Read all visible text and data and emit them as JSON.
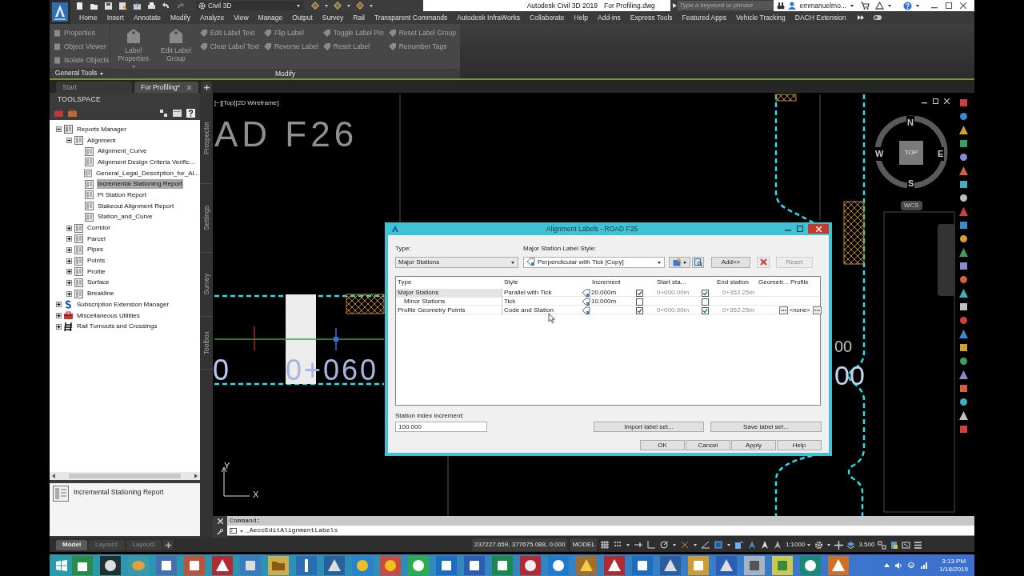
{
  "title_bar": {
    "workspace": "Civil 3D",
    "app_title": "Autodesk Civil 3D 2019",
    "file_name": "For Profiling.dwg",
    "search": {
      "placeholder": "Type a keyword or phrase"
    },
    "user": "emmanuelmo..."
  },
  "ribbon_tabs": [
    "Home",
    "Insert",
    "Annotate",
    "Modify",
    "Analyze",
    "View",
    "Manage",
    "Output",
    "Survey",
    "Rail",
    "Transparent Commands",
    "Autodesk InfraWorks",
    "Collaborate",
    "Help",
    "Add-ins",
    "Express Tools",
    "Featured Apps",
    "Vehicle Tracking",
    "DACH Extension"
  ],
  "ribbon_panels": [
    {
      "title": "General Tools",
      "items": [
        {
          "kind": "small",
          "label": "Properties",
          "disabled": true
        },
        {
          "kind": "small",
          "label": "Object Viewer",
          "disabled": true
        },
        {
          "kind": "small",
          "label": "Isolate Objects",
          "disabled": true
        }
      ]
    },
    {
      "title": "Modify",
      "items": [
        {
          "kind": "large",
          "label": "Label Properties",
          "disabled": true
        },
        {
          "kind": "large",
          "label": "Edit Label Group",
          "disabled": true
        },
        {
          "kind": "small",
          "label": "Edit Label Text",
          "disabled": true
        },
        {
          "kind": "small",
          "label": "Clear Label Text",
          "disabled": true
        },
        {
          "kind": "small",
          "label": "Flip Label",
          "disabled": true
        },
        {
          "kind": "small",
          "label": "Reverse Label",
          "disabled": true
        },
        {
          "kind": "small",
          "label": "Toggle Label Pin",
          "disabled": true
        },
        {
          "kind": "small",
          "label": "Reset Label",
          "disabled": true
        },
        {
          "kind": "small",
          "label": "Reset Label Group",
          "disabled": true
        },
        {
          "kind": "small",
          "label": "Renumber Tags",
          "disabled": true
        }
      ]
    }
  ],
  "file_tabs": [
    {
      "label": "Start",
      "selected": false
    },
    {
      "label": "For Profiling*",
      "selected": true
    }
  ],
  "toolspace": {
    "title": "TOOLSPACE",
    "tree": [
      {
        "label": "Reports Manager",
        "expanded": true,
        "selected": false,
        "children": [
          {
            "label": "Alignment",
            "expanded": true,
            "selected": false,
            "children": [
              {
                "label": "Alignment_Curve",
                "selected": false
              },
              {
                "label": "Alignment Design Criteria Verific...",
                "selected": false
              },
              {
                "label": "General_Legal_Description_for_Al...",
                "selected": false
              },
              {
                "label": "Incremental Stationing Report",
                "selected": true
              },
              {
                "label": "PI Station Report",
                "selected": false
              },
              {
                "label": "Stakeout Alignment Report",
                "selected": false
              },
              {
                "label": "Station_and_Curve",
                "selected": false
              }
            ]
          },
          {
            "label": "Corridor",
            "expanded": false,
            "selected": false
          },
          {
            "label": "Parcel",
            "expanded": false,
            "selected": false
          },
          {
            "label": "Pipes",
            "expanded": false,
            "selected": false
          },
          {
            "label": "Points",
            "expanded": false,
            "selected": false
          },
          {
            "label": "Profile",
            "expanded": false,
            "selected": false
          },
          {
            "label": "Surface",
            "expanded": false,
            "selected": false
          },
          {
            "label": "Breakline",
            "expanded": false,
            "selected": false
          }
        ]
      },
      {
        "label": "Subscription Extension Manager",
        "expanded": false,
        "selected": false
      },
      {
        "label": "Miscellaneous Utilities",
        "expanded": false,
        "selected": false
      },
      {
        "label": "Rail Turnouts and Crossings",
        "expanded": false,
        "selected": false
      }
    ],
    "side_tabs": [
      "Prospector",
      "Settings",
      "Survey",
      "Toolbox"
    ],
    "preview": "Incremental Stationing Report"
  },
  "viewport": {
    "label": "[−][Top][2D Wireframe]",
    "texts": [
      "AD F26",
      "0",
      "0+060",
      "00",
      "00"
    ],
    "viewcube": {
      "north": "N",
      "south": "S",
      "east": "E",
      "west": "W",
      "top": "TOP",
      "wcs": "WCS"
    },
    "ucs": {
      "x": "X",
      "y": "Y"
    }
  },
  "dialog": {
    "title": "Alignment Labels - ROAD F25",
    "type_label": "Type:",
    "type_value": "Major Stations",
    "style_label": "Major Station Label Style:",
    "style_value": "Perpendicular with Tick [Copy]",
    "add_button": "Add>>",
    "reset_button": {
      "label": "Reset",
      "disabled": true
    },
    "columns": [
      "Type",
      "Style",
      "Increment",
      "",
      "Start sta...",
      "",
      "End station",
      "Geometr...",
      "Profile"
    ],
    "rows": [
      {
        "type": "Major Stations",
        "style": "Parallel with Tick",
        "increment": "20.000m",
        "start_checked": true,
        "start_station": "0+000.00m",
        "end_checked": true,
        "end_station": "0+352.25m",
        "geometry_picker": false,
        "selected": true,
        "children": [
          {
            "type": "Minor Stations",
            "style": "Tick",
            "increment": "10.000m",
            "start_checked": false,
            "end_checked": false,
            "geometry_picker": false,
            "selected": false
          }
        ]
      },
      {
        "type": "Profile Geometry Points",
        "style": "Code and Station",
        "start_checked": true,
        "start_station": "0+000.00m",
        "end_checked": true,
        "end_station": "0+352.25m",
        "geometry_picker": true,
        "profile": "<none>",
        "selected": false
      }
    ],
    "index_label": "Station index increment:",
    "index_value": "100.000",
    "buttons": [
      "Import label set...",
      "Save label set..."
    ],
    "footer_buttons": [
      "OK",
      "Cancel",
      "Apply",
      "Help"
    ]
  },
  "command_line": {
    "history": "Command:",
    "input": "_AeccEditAlignmentLabels"
  },
  "layout_tabs": [
    {
      "label": "Model",
      "selected": true
    },
    {
      "label": "Layout1",
      "selected": false
    },
    {
      "label": "Layout2",
      "selected": false
    }
  ],
  "status_bar": {
    "coordinates": "237227.659, 377675.088, 0.000",
    "space": "MODEL",
    "scale": "1:1000",
    "annotation_value": "3.500"
  },
  "taskbar": {
    "time": "3:13 PM",
    "date": "1/18/2019"
  }
}
